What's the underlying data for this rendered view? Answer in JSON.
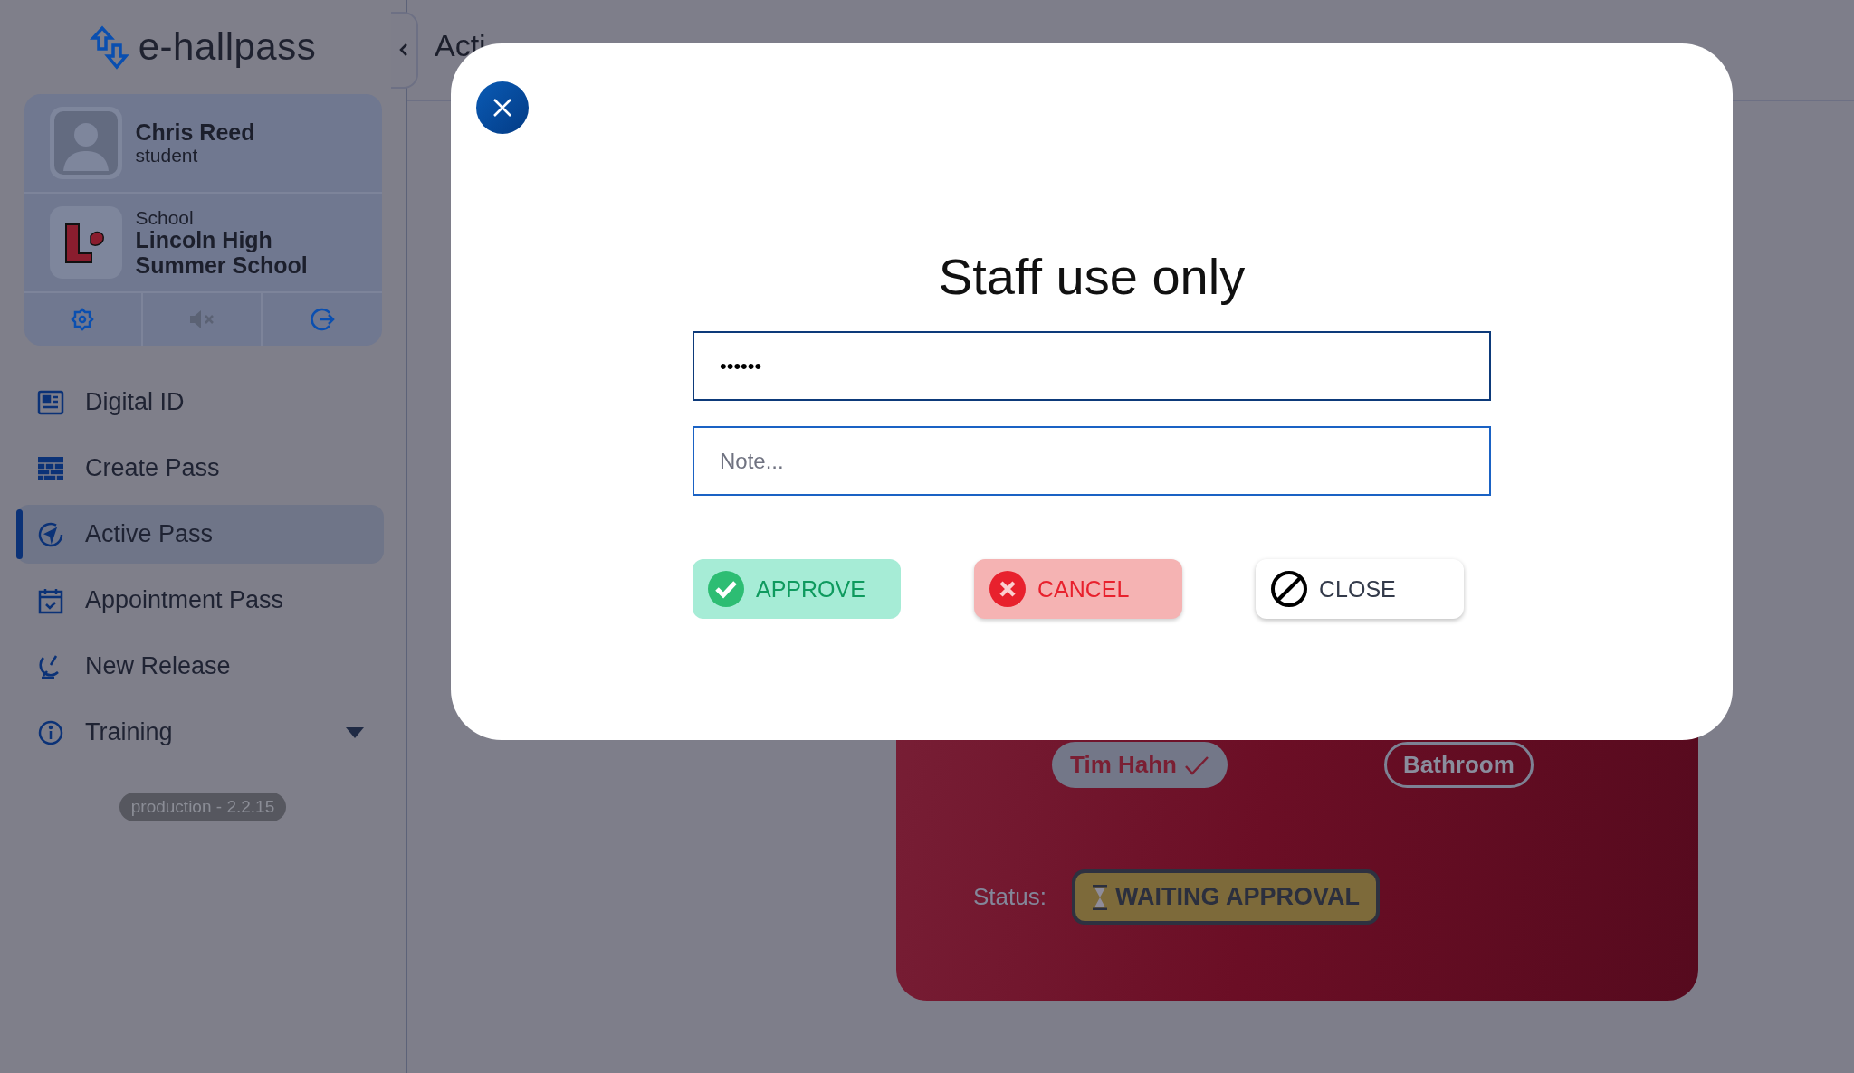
{
  "sidebar": {
    "logo": "e-hallpass",
    "profile": {
      "name": "Chris Reed",
      "role": "student"
    },
    "school": {
      "label": "School",
      "name": "Lincoln High Summer School"
    },
    "nav": [
      {
        "kind": "id",
        "label": "Digital ID",
        "selected": false
      },
      {
        "kind": "grid",
        "label": "Create Pass",
        "selected": false
      },
      {
        "kind": "compass",
        "label": "Active Pass",
        "selected": true
      },
      {
        "kind": "calendar",
        "label": "Appointment Pass",
        "selected": false
      },
      {
        "kind": "release",
        "label": "New Release",
        "selected": false
      },
      {
        "kind": "info",
        "label": "Training",
        "selected": false,
        "expanded": false
      }
    ],
    "version": "production - 2.2.15"
  },
  "header": {
    "title": "Acti"
  },
  "pass": {
    "teacher": "Tim Hahn",
    "teacher_approved": true,
    "destination": "Bathroom",
    "status_label": "Status:",
    "status": "WAITING APPROVAL"
  },
  "modal": {
    "title": "Staff use only",
    "password": {
      "value": "••••••"
    },
    "note": {
      "placeholder": "Note..."
    },
    "buttons": [
      {
        "kind": "approve",
        "label": "APPROVE"
      },
      {
        "kind": "cancel",
        "label": "CANCEL"
      },
      {
        "kind": "close",
        "label": "CLOSE"
      }
    ]
  }
}
